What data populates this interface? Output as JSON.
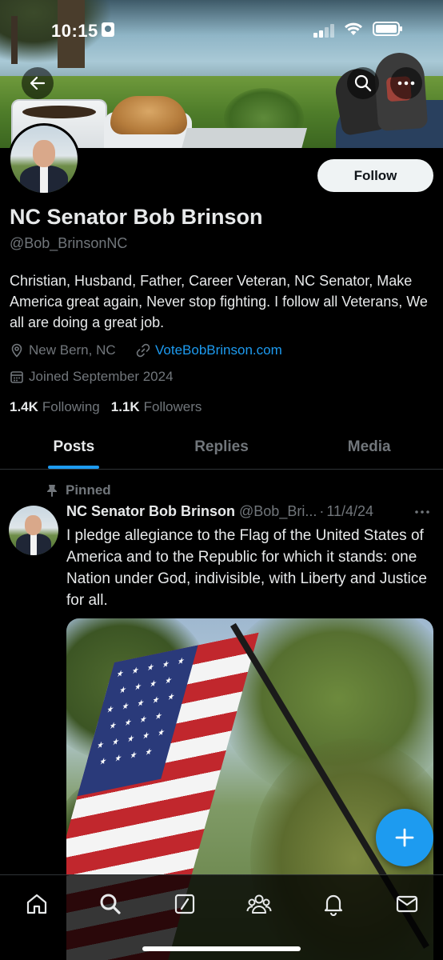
{
  "status_bar": {
    "time": "10:15"
  },
  "profile": {
    "name": "NC Senator Bob Brinson",
    "handle": "@Bob_BrinsonNC",
    "bio": "Christian, Husband, Father, Career Veteran, NC Senator, Make America great again, Never stop fighting. I follow all Veterans, We all are doing a great job.",
    "location": "New Bern, NC",
    "website": "VoteBobBrinson.com",
    "joined": "Joined September 2024",
    "following_count": "1.4K",
    "following_label": "Following",
    "followers_count": "1.1K",
    "followers_label": "Followers",
    "follow_button": "Follow"
  },
  "tabs": [
    {
      "label": "Posts",
      "active": true
    },
    {
      "label": "Replies",
      "active": false
    },
    {
      "label": "Media",
      "active": false
    }
  ],
  "post": {
    "pinned_label": "Pinned",
    "author_name": "NC Senator Bob Brinson",
    "author_handle": "@Bob_Bri...",
    "separator": "·",
    "date": "11/4/24",
    "text": "I pledge allegiance to the Flag of the United States of America and to the Republic for which it stands: one Nation under God, indivisible, with Liberty and Justice for all."
  },
  "icons": {
    "back": "back-arrow-icon",
    "search": "search-icon",
    "more": "more-icon",
    "location": "location-pin-icon",
    "link": "link-icon",
    "calendar": "calendar-icon",
    "pin": "pin-icon",
    "compose": "plus-icon",
    "nav": [
      "home-icon",
      "search-icon",
      "grok-icon",
      "communities-icon",
      "notifications-icon",
      "messages-icon"
    ]
  },
  "colors": {
    "accent": "#1d9bf0",
    "background": "#000000",
    "text": "#e7e9ea",
    "muted": "#71767b"
  }
}
